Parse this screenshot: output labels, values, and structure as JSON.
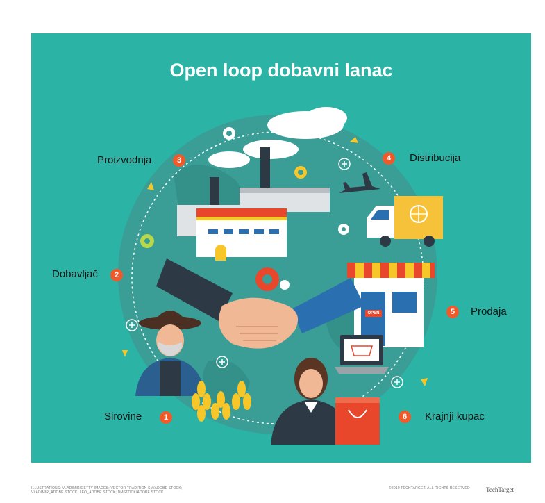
{
  "title": "Open loop dobavni lanac",
  "stages": [
    {
      "num": "1",
      "label": "Sirovine"
    },
    {
      "num": "2",
      "label": "Dobavljač"
    },
    {
      "num": "3",
      "label": "Proizvodnja"
    },
    {
      "num": "4",
      "label": "Distribucija"
    },
    {
      "num": "5",
      "label": "Prodaja"
    },
    {
      "num": "6",
      "label": "Krajnji kupac"
    }
  ],
  "shop_sign": "OPEN",
  "credits": {
    "left": "ILLUSTRATIONS: VLADIMIR/GETTY IMAGES; VECTOR TRADITION SM/ADOBE STOCK; VLADIMIR_ADOBE STOCK; LEO_ADOBE STOCK; DMSTOCK/ADOBE STOCK",
    "right": "©2019 TECHTARGET. ALL RIGHTS RESERVED",
    "brand": "TechTarget"
  },
  "colors": {
    "panel": "#2bb3a5",
    "badge": "#f05a2b",
    "globe": "#3a9d96",
    "awning_red": "#e8472c",
    "awning_yellow": "#f7c72a"
  }
}
